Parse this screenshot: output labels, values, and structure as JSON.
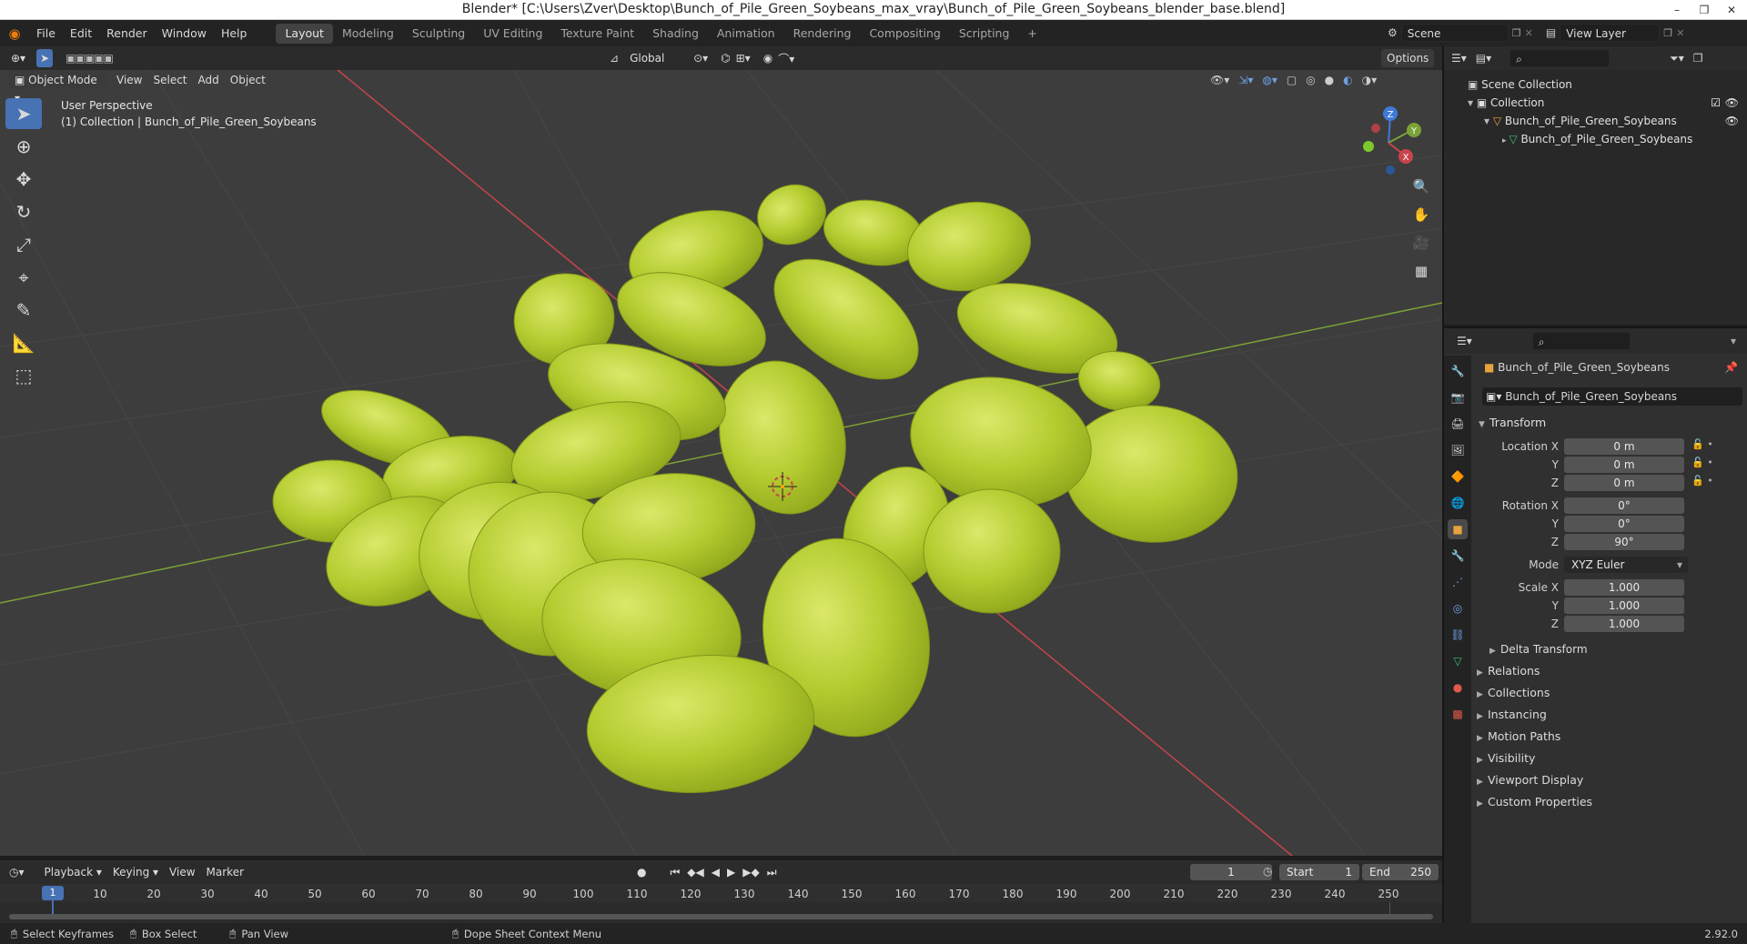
{
  "window": {
    "title": "Blender* [C:\\Users\\Zver\\Desktop\\Bunch_of_Pile_Green_Soybeans_max_vray\\Bunch_of_Pile_Green_Soybeans_blender_base.blend]",
    "minimize": "–",
    "restore": "❐",
    "close": "✕"
  },
  "menu": {
    "items": [
      "File",
      "Edit",
      "Render",
      "Window",
      "Help"
    ]
  },
  "workspaces": {
    "tabs": [
      "Layout",
      "Modeling",
      "Sculpting",
      "UV Editing",
      "Texture Paint",
      "Shading",
      "Animation",
      "Rendering",
      "Compositing",
      "Scripting"
    ],
    "active": "Layout",
    "add": "+"
  },
  "scene": {
    "name": "Scene",
    "view_layer": "View Layer"
  },
  "viewport": {
    "orientation": "Global",
    "options_label": "Options",
    "mode": "Object Mode",
    "menus": [
      "View",
      "Select",
      "Add",
      "Object"
    ],
    "perspective_text": "User Perspective",
    "collection_text": "(1) Collection | Bunch_of_Pile_Green_Soybeans",
    "gizmo": {
      "x": "X",
      "y": "Y",
      "z": "Z"
    }
  },
  "outliner": {
    "rows": [
      {
        "label": "Scene Collection"
      },
      {
        "label": "Collection"
      },
      {
        "label": "Bunch_of_Pile_Green_Soybeans"
      },
      {
        "label": "Bunch_of_Pile_Green_Soybeans"
      }
    ]
  },
  "properties": {
    "object_name": "Bunch_of_Pile_Green_Soybeans",
    "name_field": "Bunch_of_Pile_Green_Soybeans",
    "transform_label": "Transform",
    "location_label": "Location X",
    "rotation_label": "Rotation X",
    "scale_label": "Scale X",
    "mode_label": "Mode",
    "y_label": "Y",
    "z_label": "Z",
    "location": [
      "0 m",
      "0 m",
      "0 m"
    ],
    "rotation": [
      "0°",
      "0°",
      "90°"
    ],
    "mode": "XYZ Euler",
    "scale": [
      "1.000",
      "1.000",
      "1.000"
    ],
    "delta_label": "Delta Transform",
    "sections": [
      "Relations",
      "Collections",
      "Instancing",
      "Motion Paths",
      "Visibility",
      "Viewport Display",
      "Custom Properties"
    ]
  },
  "timeline": {
    "menus": [
      "Playback",
      "Keying",
      "View",
      "Marker"
    ],
    "current_frame": "1",
    "start_label": "Start",
    "start": "1",
    "end_label": "End",
    "end": "250",
    "ticks": [
      "10",
      "20",
      "30",
      "40",
      "50",
      "60",
      "70",
      "80",
      "90",
      "100",
      "110",
      "120",
      "130",
      "140",
      "150",
      "160",
      "170",
      "180",
      "190",
      "200",
      "210",
      "220",
      "230",
      "240",
      "250"
    ],
    "playhead": "1"
  },
  "status": {
    "select": "Select Keyframes",
    "box": "Box Select",
    "pan": "Pan View",
    "context": "Dope Sheet Context Menu",
    "version": "2.92.0"
  },
  "colors": {
    "accent": "#4772b3",
    "bean": "#b5cc30",
    "x_axis": "#c8444c",
    "y_axis": "#7aa236"
  }
}
